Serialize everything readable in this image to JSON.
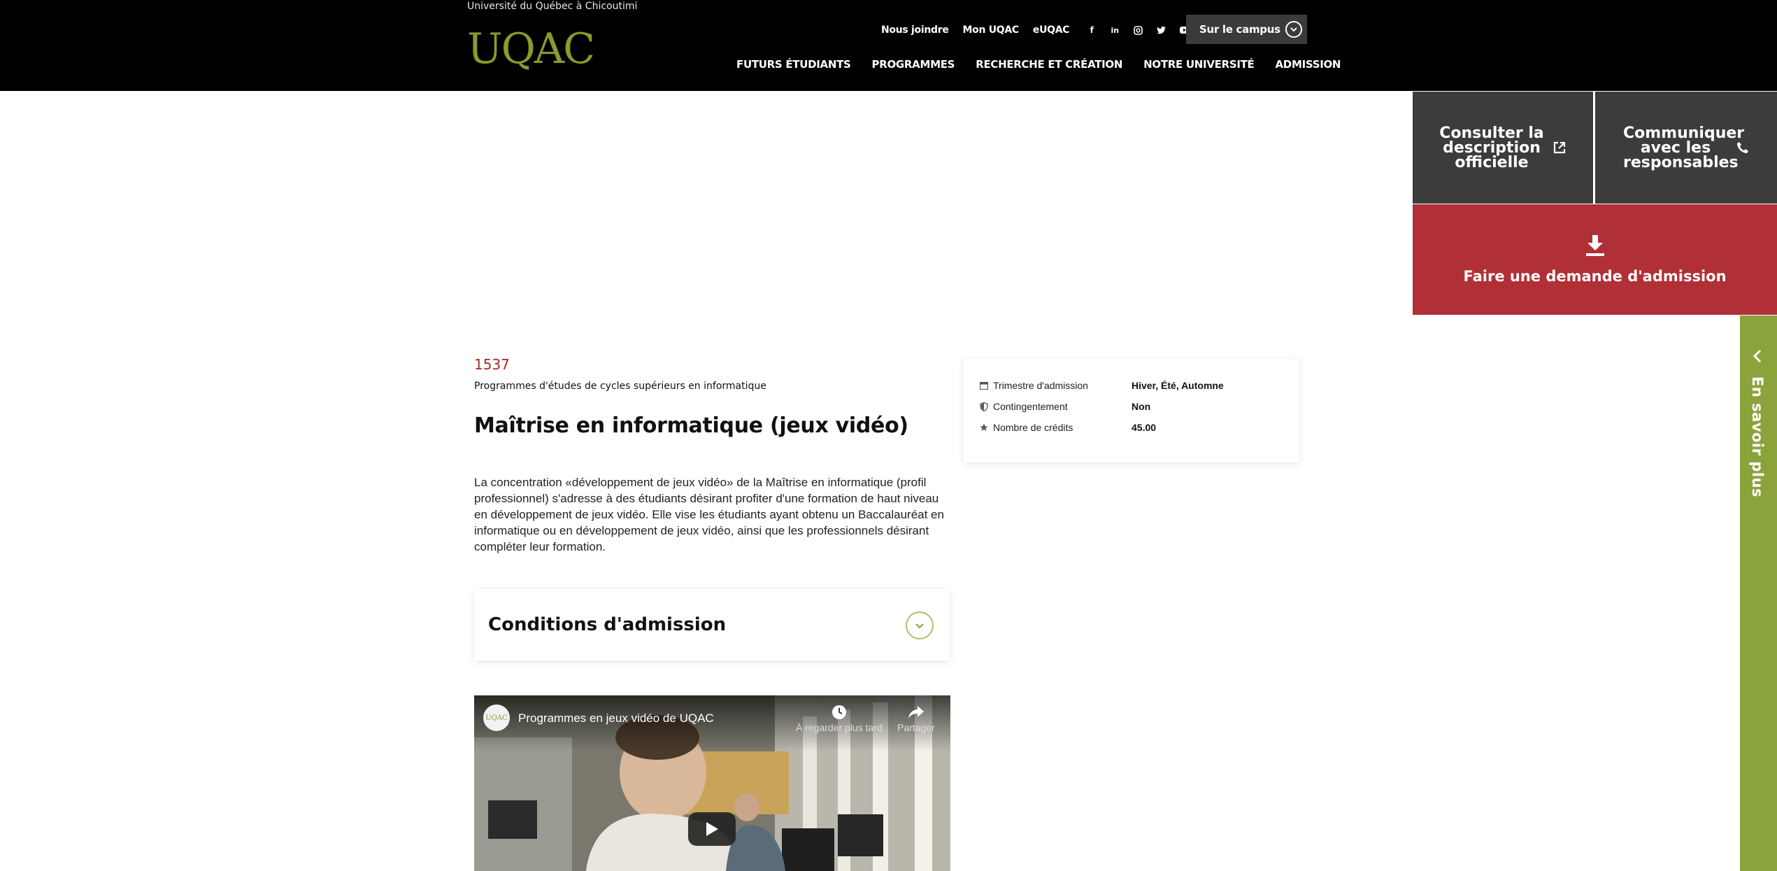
{
  "header": {
    "university_name": "Université du Québec à Chicoutimi",
    "logo_text": "UQAC",
    "util_links": [
      {
        "label": "Nous joindre"
      },
      {
        "label": "Mon UQAC"
      },
      {
        "label": "eUQAC"
      }
    ],
    "social_icons": [
      "facebook-icon",
      "linkedin-icon",
      "instagram-icon",
      "twitter-icon",
      "youtube-icon"
    ],
    "campus_button": "Sur le campus",
    "main_nav": [
      {
        "label": "FUTURS ÉTUDIANTS"
      },
      {
        "label": "PROGRAMMES"
      },
      {
        "label": "RECHERCHE ET CRÉATION"
      },
      {
        "label": "NOTRE UNIVERSITÉ"
      },
      {
        "label": "ADMISSION"
      }
    ]
  },
  "actions": {
    "official_description": "Consulter la description officielle",
    "contact": "Communiquer avec les responsables",
    "apply": "Faire une demande d'admission"
  },
  "side_tab": {
    "label": "En savoir plus"
  },
  "program": {
    "code": "1537",
    "category": "Programmes d'études de cycles supérieurs en informatique",
    "title": "Maîtrise en informatique (jeux vidéo)",
    "description": "La concentration «développement de jeux vidéo» de la Maîtrise en informatique (profil professionnel) s'adresse à des étudiants désirant profiter d'une formation de haut niveau en développement de jeux vidéo. Elle vise les étudiants ayant obtenu un Baccalauréat en informatique ou en développement de jeux vidéo, ainsi que les professionnels désirant compléter leur formation."
  },
  "info": [
    {
      "icon": "calendar-icon",
      "label": "Trimestre d'admission",
      "value": "Hiver, Été, Automne"
    },
    {
      "icon": "shield-icon",
      "label": "Contingentement",
      "value": "Non"
    },
    {
      "icon": "star-icon",
      "label": "Nombre de crédits",
      "value": "45.00"
    }
  ],
  "accordion": {
    "title": "Conditions d'admission"
  },
  "video": {
    "channel_logo": "UQAC",
    "title": "Programmes en jeux vidéo de UQAC",
    "watch_later": "À regarder plus tard",
    "share": "Partager"
  },
  "colors": {
    "header_bg": "#000000",
    "brand_green": "#8aa33b",
    "apply_red": "#b12f36",
    "tile_gray": "#3c3c3c",
    "code_red": "#a52a2a"
  }
}
